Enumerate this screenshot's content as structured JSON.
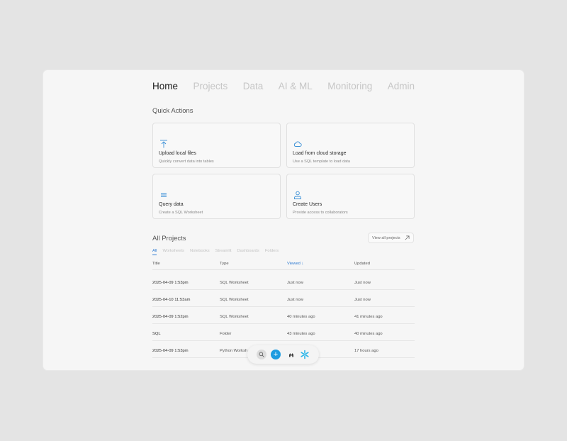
{
  "nav": {
    "items": [
      "Home",
      "Projects",
      "Data",
      "AI & ML",
      "Monitoring",
      "Admin"
    ],
    "active": "Home"
  },
  "quick_actions": {
    "title": "Quick Actions",
    "cards": [
      {
        "title": "Upload local files",
        "desc": "Quickly convert data into tables",
        "icon": "upload-icon"
      },
      {
        "title": "Load from cloud storage",
        "desc": "Use a SQL template to load data",
        "icon": "cloud-icon"
      },
      {
        "title": "Query data",
        "desc": "Create a SQL Worksheet",
        "icon": "list-icon"
      },
      {
        "title": "Create Users",
        "desc": "Provide access to collaborators",
        "icon": "user-icon"
      }
    ]
  },
  "projects": {
    "title": "All Projects",
    "view_all": "View all projects",
    "tabs": [
      "All",
      "Worksheets",
      "Notebooks",
      "Streamlit",
      "Dashboards",
      "Folders"
    ],
    "active_tab": "All",
    "columns": [
      "Title",
      "Type",
      "Viewed",
      "Updated"
    ],
    "sort_column": "Viewed",
    "sort_glyph": "↓",
    "rows": [
      [
        "2025-04-09 1:53pm",
        "SQL Worksheet",
        "Just now",
        "Just now"
      ],
      [
        "2025-04-10 11:53am",
        "SQL Worksheet",
        "Just now",
        "Just now"
      ],
      [
        "2025-04-09 1:52pm",
        "SQL Worksheet",
        "40 minutes ago",
        "41 minutes ago"
      ],
      [
        "SQL",
        "Folder",
        "43 minutes ago",
        "40 minutes ago"
      ],
      [
        "2025-04-09 1:53pm",
        "Python Worksh",
        "",
        "17 hours ago"
      ]
    ]
  },
  "dock": {
    "plus": "+",
    "icons": [
      "search-icon",
      "plus-icon",
      "assistant-icon",
      "snowflake-logo-icon"
    ],
    "accent": "#1e9ce0"
  },
  "colors": {
    "accent": "#2e7ad1",
    "icon": "#3a8fd6"
  }
}
